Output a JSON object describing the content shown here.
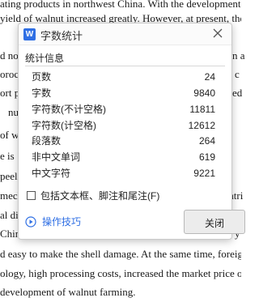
{
  "document": {
    "lines": [
      "ating products in northwest China. With the development of",
      "yield of walnut increased greatly. However, at present, there",
      "d not",
      "oroce",
      "ort pr",
      "nuc",
      "of w",
      "e is",
      "peelin",
      "mech",
      "al dis",
      "Chin",
      "d easy to make the shell damage. At the same time, foreign",
      "ology, high processing costs, increased the market price of walnut",
      "development of walnut farming."
    ],
    "right_fragments": [
      "n a",
      "c",
      "ed",
      "atri",
      "ety",
      "y"
    ]
  },
  "dialog": {
    "app_icon_letter": "W",
    "title": "字数统计",
    "section_title": "统计信息",
    "stats": [
      {
        "label": "页数",
        "value": "24"
      },
      {
        "label": "字数",
        "value": "9840"
      },
      {
        "label": "字符数(不计空格)",
        "value": "11811"
      },
      {
        "label": "字符数(计空格)",
        "value": "12612"
      },
      {
        "label": "段落数",
        "value": "264"
      },
      {
        "label": "非中文单词",
        "value": "619"
      },
      {
        "label": "中文字符",
        "value": "9221"
      }
    ],
    "checkbox_label": "包括文本框、脚注和尾注(F)",
    "checkbox_checked": false,
    "tips_label": "操作技巧",
    "close_label": "关闭",
    "accent_color": "#2f6fe4"
  }
}
